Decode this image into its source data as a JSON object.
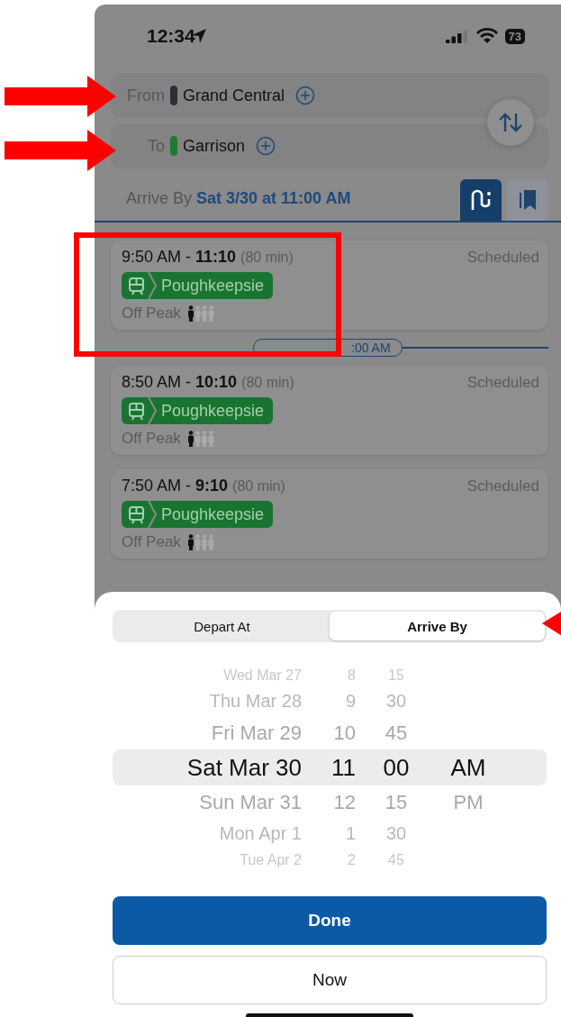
{
  "status_bar": {
    "time": "12:34",
    "battery": "73"
  },
  "route": [
    {
      "label": "From",
      "station": "Grand Central",
      "color": "#2b2f36"
    },
    {
      "label": "To",
      "station": "Garrison",
      "color": "#1d7a32"
    }
  ],
  "time_filter": {
    "label": "Arrive By",
    "value": "Sat 3/30 at 11:00 AM"
  },
  "view_tabs": [
    {
      "kind": "routes",
      "selected": true
    },
    {
      "kind": "saved",
      "selected": false
    }
  ],
  "trips": [
    {
      "depart": "9:50 AM - ",
      "arrive": "11:10",
      "duration": "(80 min)",
      "status": "Scheduled",
      "line": "Poughkeepsie",
      "fare": "Off Peak",
      "crowding": {
        "level": 0.25
      }
    },
    {
      "depart": "8:50 AM - ",
      "arrive": "10:10",
      "duration": "(80 min)",
      "status": "Scheduled",
      "line": "Poughkeepsie",
      "fare": "Off Peak",
      "crowding": {
        "level": 0.25
      }
    },
    {
      "depart": "7:50 AM - ",
      "arrive": "9:10",
      "duration": "(80 min)",
      "status": "Scheduled",
      "line": "Poughkeepsie",
      "fare": "Off Peak",
      "crowding": {
        "level": 0.25
      }
    }
  ],
  "time_marker": {
    "label": ":00 AM"
  },
  "sheet": {
    "mode_tabs": [
      {
        "label": "Depart At",
        "selected": false
      },
      {
        "label": "Arrive By",
        "selected": true
      }
    ],
    "picker_rows": [
      {
        "day": "Wed Mar 27",
        "hour": "8",
        "minute": "15",
        "selected": false
      },
      {
        "day": "Thu Mar 28",
        "hour": "9",
        "minute": "30",
        "selected": false
      },
      {
        "day": "Fri Mar 29",
        "hour": "10",
        "minute": "45",
        "selected": false
      },
      {
        "day": "Sat Mar 30",
        "hour": "11",
        "minute": "00",
        "period": "AM",
        "selected": true
      },
      {
        "day": "Sun Mar 31",
        "hour": "12",
        "minute": "15",
        "period": "PM",
        "selected": false
      },
      {
        "day": "Mon Apr 1",
        "hour": "1",
        "minute": "30",
        "selected": false
      },
      {
        "day": "Tue Apr 2",
        "hour": "2",
        "minute": "45",
        "selected": false
      }
    ],
    "buttons": [
      {
        "label": "Done",
        "kind": "primary"
      },
      {
        "label": "Now",
        "kind": "secondary"
      }
    ]
  }
}
